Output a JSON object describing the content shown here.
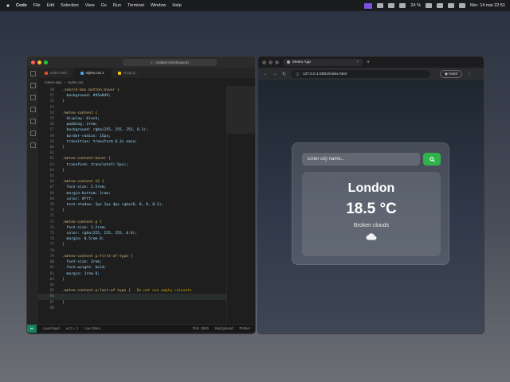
{
  "menubar": {
    "app_name": "Code",
    "menus": [
      "File",
      "Edit",
      "Selection",
      "View",
      "Go",
      "Run",
      "Terminal",
      "Window",
      "Help"
    ],
    "battery": "24 %",
    "datetime": "Mer. 14 mai 22:51"
  },
  "vscode": {
    "search_text": "Untitled (Workspace)",
    "tabs": [
      {
        "label": "index.html",
        "color": "#e44d26"
      },
      {
        "label": "styles.css 1",
        "color": "#42a5f5"
      },
      {
        "label": "script.js",
        "color": "#f1c40f"
      }
    ],
    "breadcrumb": [
      "meteo-app",
      "styles.css"
    ],
    "code_lines": [
      {
        "n": "50",
        "t": ".search-box button:hover {"
      },
      {
        "n": "51",
        "t": "  background: #45a049;"
      },
      {
        "n": "52",
        "t": "}"
      },
      {
        "n": "53",
        "t": ""
      },
      {
        "n": "54",
        "t": ".meteo-content {"
      },
      {
        "n": "55",
        "t": "  display: block;"
      },
      {
        "n": "56",
        "t": "  padding: 2rem;"
      },
      {
        "n": "57",
        "t": "  background: rgba(255, 255, 255, 0.1);"
      },
      {
        "n": "58",
        "t": "  border-radius: 15px;"
      },
      {
        "n": "59",
        "t": "  transition: transform 0.3s ease;"
      },
      {
        "n": "60",
        "t": "}"
      },
      {
        "n": "61",
        "t": ""
      },
      {
        "n": "62",
        "t": ".meteo-content:hover {"
      },
      {
        "n": "63",
        "t": "  transform: translateY(-5px);"
      },
      {
        "n": "64",
        "t": "}"
      },
      {
        "n": "65",
        "t": ""
      },
      {
        "n": "66",
        "t": ".meteo-content h2 {"
      },
      {
        "n": "67",
        "t": "  font-size: 2.5rem;"
      },
      {
        "n": "68",
        "t": "  margin-bottom: 1rem;"
      },
      {
        "n": "69",
        "t": "  color: #fff;"
      },
      {
        "n": "70",
        "t": "  text-shadow: 2px 2px 4px rgba(0, 0, 0, 0.2);"
      },
      {
        "n": "71",
        "t": "}"
      },
      {
        "n": "72",
        "t": ""
      },
      {
        "n": "73",
        "t": ".meteo-content p {"
      },
      {
        "n": "74",
        "t": "  font-size: 1.2rem;"
      },
      {
        "n": "75",
        "t": "  color: rgba(255, 255, 255, 0.9);"
      },
      {
        "n": "76",
        "t": "  margin: 0.5rem 0;"
      },
      {
        "n": "77",
        "t": "}"
      },
      {
        "n": "78",
        "t": ""
      },
      {
        "n": "79",
        "t": ".meteo-content p:first-of-type {"
      },
      {
        "n": "80",
        "t": "  font-size: 3rem;"
      },
      {
        "n": "81",
        "t": "  font-weight: bold;"
      },
      {
        "n": "82",
        "t": "  margin: 1rem 0;"
      },
      {
        "n": "83",
        "t": "}"
      },
      {
        "n": "84",
        "t": ""
      },
      {
        "n": "85",
        "t": ".meteo-content p:last-of-type {"
      },
      {
        "n": "86",
        "t": ""
      },
      {
        "n": "87",
        "t": "}"
      },
      {
        "n": "88",
        "t": ""
      }
    ],
    "lint_warning": "Do not use empty rulesets",
    "status": {
      "errors": "0",
      "warnings": "1",
      "live_share": "Live Share",
      "port": "Port : 5501",
      "background": "Background",
      "prettier": "Prettier",
      "launchpad": "Launchpad"
    }
  },
  "browser": {
    "tab_title": "Meteo App",
    "url": "127.0.0.1:5501/index.html",
    "invite_label": "Invité"
  },
  "app": {
    "input_placeholder": "Enter city name...",
    "city": "London",
    "temperature": "18.5 °C",
    "description": "Broken clouds",
    "button_color": "#2fb34a"
  }
}
